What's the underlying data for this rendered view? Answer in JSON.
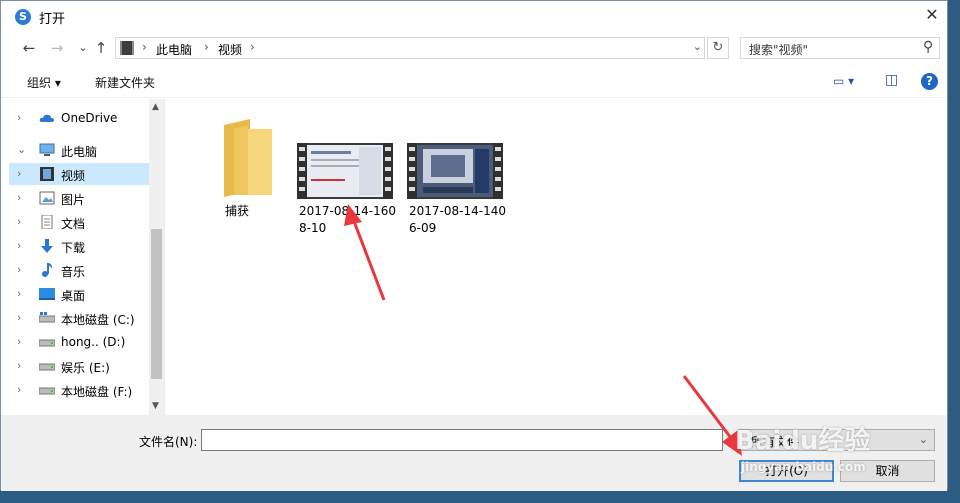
{
  "window": {
    "title": "打开",
    "close_glyph": "✕"
  },
  "nav": {
    "back": "←",
    "forward": "→",
    "recent": "⌄",
    "up": "↑",
    "breadcrumb": [
      "此电脑",
      "视频"
    ],
    "refresh": "↻",
    "search_placeholder": "搜索\"视频\"",
    "search_icon": "⚲"
  },
  "commandbar": {
    "organize": "组织 ▾",
    "new_folder": "新建文件夹",
    "view_glyph": "▭ ▾",
    "pane_glyph": "◫",
    "help": "?"
  },
  "sidebar": {
    "items": [
      {
        "label": "OneDrive",
        "chevron": "›",
        "icon": "cloud-icon"
      },
      {
        "label": "此电脑",
        "chevron": "⌄",
        "icon": "computer-icon"
      },
      {
        "label": "视频",
        "chevron": "›",
        "icon": "video-folder-icon",
        "selected": true
      },
      {
        "label": "图片",
        "chevron": "›",
        "icon": "pictures-icon"
      },
      {
        "label": "文档",
        "chevron": "›",
        "icon": "documents-icon"
      },
      {
        "label": "下载",
        "chevron": "›",
        "icon": "downloads-icon"
      },
      {
        "label": "音乐",
        "chevron": "›",
        "icon": "music-icon"
      },
      {
        "label": "桌面",
        "chevron": "›",
        "icon": "desktop-icon"
      },
      {
        "label": "本地磁盘 (C:)",
        "chevron": "›",
        "icon": "drive-icon"
      },
      {
        "label": "hong.. (D:)",
        "chevron": "›",
        "icon": "drive-icon"
      },
      {
        "label": "娱乐 (E:)",
        "chevron": "›",
        "icon": "drive-icon"
      },
      {
        "label": "本地磁盘 (F:)",
        "chevron": "›",
        "icon": "drive-icon"
      }
    ],
    "scroll_up": "▲",
    "scroll_down": "▼"
  },
  "files": [
    {
      "name": "捕获",
      "type": "folder"
    },
    {
      "name": "2017-08-14-1608-10",
      "type": "video"
    },
    {
      "name": "2017-08-14-1406-09",
      "type": "video"
    }
  ],
  "footer": {
    "filename_label": "文件名(N):",
    "filename_value": "",
    "dropdown_glyph": "⌄",
    "filetype": "所有文件",
    "open_button": "打开(O)",
    "cancel_button": "取消"
  },
  "watermark": {
    "brand": "Baidu经验",
    "url": "jingyan.baidu.com"
  },
  "colors": {
    "accent": "#1f64c7",
    "selection": "#cce8ff",
    "arrow": "#e8383d",
    "folder": "#f6d67a"
  }
}
